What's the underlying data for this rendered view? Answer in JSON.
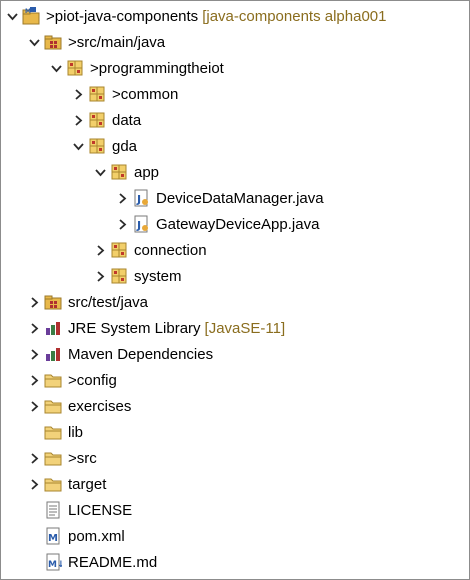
{
  "explorer": {
    "rows": [
      {
        "depth": 0,
        "twisty": "expanded",
        "icon": "java-project-icon",
        "decor": "> ",
        "label": "piot-java-components",
        "extra": "[java-components alpha001"
      },
      {
        "depth": 1,
        "twisty": "expanded",
        "icon": "source-folder-icon",
        "decor": "> ",
        "label": "src/main/java",
        "extra": ""
      },
      {
        "depth": 2,
        "twisty": "expanded",
        "icon": "package-icon",
        "decor": "> ",
        "label": "programmingtheiot",
        "extra": ""
      },
      {
        "depth": 3,
        "twisty": "collapsed",
        "icon": "package-icon",
        "decor": "> ",
        "label": "common",
        "extra": ""
      },
      {
        "depth": 3,
        "twisty": "collapsed",
        "icon": "package-icon",
        "decor": "",
        "label": "data",
        "extra": ""
      },
      {
        "depth": 3,
        "twisty": "expanded",
        "icon": "package-icon",
        "decor": "",
        "label": "gda",
        "extra": ""
      },
      {
        "depth": 4,
        "twisty": "expanded",
        "icon": "package-icon",
        "decor": "",
        "label": "app",
        "extra": ""
      },
      {
        "depth": 5,
        "twisty": "collapsed",
        "icon": "java-file-icon",
        "decor": "",
        "label": "DeviceDataManager.java",
        "extra": ""
      },
      {
        "depth": 5,
        "twisty": "collapsed",
        "icon": "java-file-icon",
        "decor": "",
        "label": "GatewayDeviceApp.java",
        "extra": ""
      },
      {
        "depth": 4,
        "twisty": "collapsed",
        "icon": "package-icon",
        "decor": "",
        "label": "connection",
        "extra": ""
      },
      {
        "depth": 4,
        "twisty": "collapsed",
        "icon": "package-icon",
        "decor": "",
        "label": "system",
        "extra": ""
      },
      {
        "depth": 1,
        "twisty": "collapsed",
        "icon": "source-folder-icon",
        "decor": "",
        "label": "src/test/java",
        "extra": ""
      },
      {
        "depth": 1,
        "twisty": "collapsed",
        "icon": "library-icon",
        "decor": "",
        "label": "JRE System Library",
        "extra": "[JavaSE-11]"
      },
      {
        "depth": 1,
        "twisty": "collapsed",
        "icon": "library-icon",
        "decor": "",
        "label": "Maven Dependencies",
        "extra": ""
      },
      {
        "depth": 1,
        "twisty": "collapsed",
        "icon": "folder-icon",
        "decor": "> ",
        "label": "config",
        "extra": ""
      },
      {
        "depth": 1,
        "twisty": "collapsed",
        "icon": "folder-icon",
        "decor": "",
        "label": "exercises",
        "extra": ""
      },
      {
        "depth": 1,
        "twisty": "none",
        "icon": "folder-icon",
        "decor": "",
        "label": "lib",
        "extra": ""
      },
      {
        "depth": 1,
        "twisty": "collapsed",
        "icon": "folder-icon",
        "decor": "> ",
        "label": "src",
        "extra": ""
      },
      {
        "depth": 1,
        "twisty": "collapsed",
        "icon": "folder-icon",
        "decor": "",
        "label": "target",
        "extra": ""
      },
      {
        "depth": 1,
        "twisty": "none",
        "icon": "text-file-icon",
        "decor": "",
        "label": "LICENSE",
        "extra": ""
      },
      {
        "depth": 1,
        "twisty": "none",
        "icon": "maven-file-icon",
        "decor": "",
        "label": "pom.xml",
        "extra": ""
      },
      {
        "depth": 1,
        "twisty": "none",
        "icon": "markdown-file-icon",
        "decor": "",
        "label": "README.md",
        "extra": ""
      }
    ]
  }
}
